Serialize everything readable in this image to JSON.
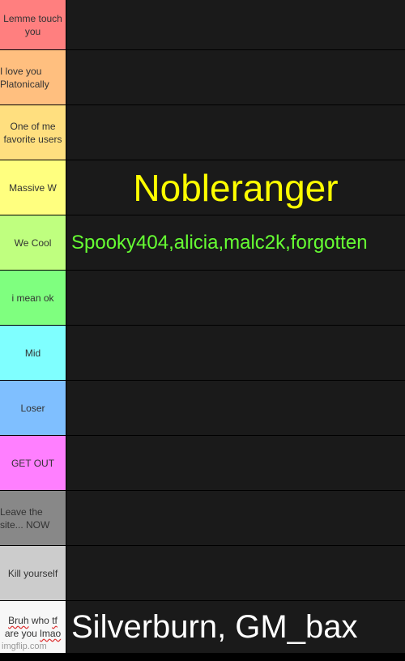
{
  "tiers": [
    {
      "label": "Lemme touch you",
      "color": "#ff7f7f",
      "items": ""
    },
    {
      "label": "I love you Platonically",
      "color": "#ffbf7f",
      "items": ""
    },
    {
      "label": "One of me favorite users",
      "color": "#ffdf7f",
      "items": ""
    },
    {
      "label": "Massive W",
      "color": "#ffff7f",
      "items": "Nobleranger",
      "item_color": "#ffff00"
    },
    {
      "label": "We Cool",
      "color": "#bfff7f",
      "items": "Spooky404,alicia,malc2k,forgotten",
      "item_color": "#66ff33"
    },
    {
      "label": "i mean ok",
      "color": "#7fff7f",
      "items": ""
    },
    {
      "label": "Mid",
      "color": "#7fffff",
      "items": ""
    },
    {
      "label": "Loser",
      "color": "#7fbfff",
      "items": ""
    },
    {
      "label": "GET OUT",
      "color": "#ff7fff",
      "items": ""
    },
    {
      "label": "Leave the site... NOW",
      "color": "#888888",
      "items": ""
    },
    {
      "label": "Kill yourself",
      "color": "#cccccc",
      "items": ""
    },
    {
      "label_line1_a": "Bruh",
      "label_line1_b": " who ",
      "label_line1_c": "tf",
      "label_line2_a": "are you ",
      "label_line2_b": "lmao",
      "color": "#f7f7f7",
      "items": "Silverburn, GM_bax",
      "item_color": "#ffffff"
    }
  ],
  "watermark": "imgflip.com"
}
